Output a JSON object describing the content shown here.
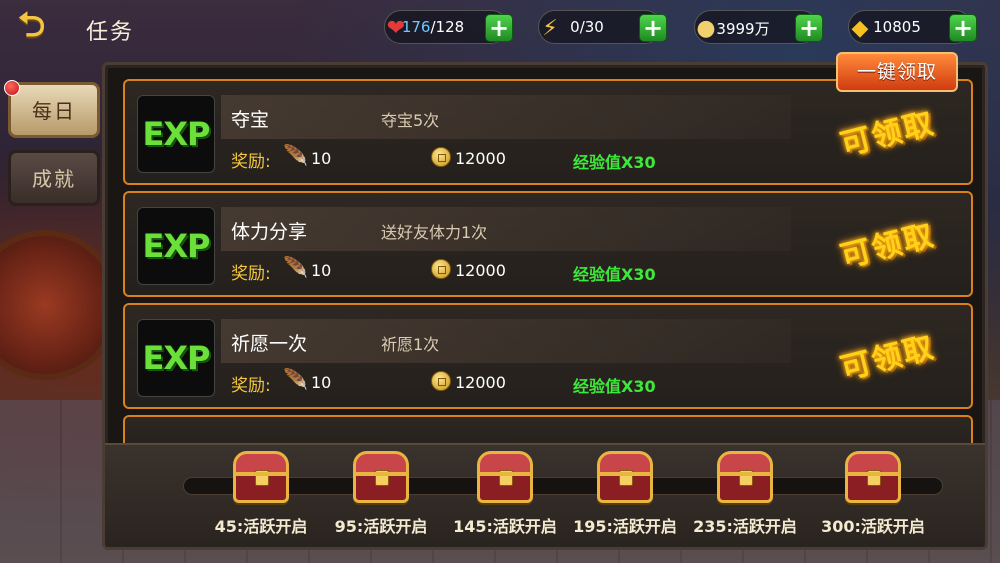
{
  "header": {
    "title": "任务",
    "back_icon": "back-arrow-icon"
  },
  "resources": [
    {
      "icon": "heart-icon",
      "current": "176",
      "max": "/128",
      "color": "#e23a3a"
    },
    {
      "icon": "lightning-icon",
      "value": "0/30",
      "color": "#f2c640"
    },
    {
      "icon": "coin-icon",
      "value": "3999万",
      "color": "#f2d070"
    },
    {
      "icon": "gold-ingot-icon",
      "value": "10805",
      "color": "#f5c020"
    }
  ],
  "side_tabs": {
    "daily": "每日",
    "achievement": "成就"
  },
  "claim_all": "一键领取",
  "tasks": [
    {
      "name": "夺宝",
      "desc": "夺宝5次",
      "reward_label": "奖励:",
      "wing": "10",
      "coins": "12000",
      "xp": "经验值X30",
      "status": "可领取",
      "icon_text": "EXP"
    },
    {
      "name": "体力分享",
      "desc": "送好友体力1次",
      "reward_label": "奖励:",
      "wing": "10",
      "coins": "12000",
      "xp": "经验值X30",
      "status": "可领取",
      "icon_text": "EXP"
    },
    {
      "name": "祈愿一次",
      "desc": "祈愿1次",
      "reward_label": "奖励:",
      "wing": "10",
      "coins": "12000",
      "xp": "经验值X30",
      "status": "可领取",
      "icon_text": "EXP"
    }
  ],
  "chests": [
    {
      "label": "45:活跃开启"
    },
    {
      "label": "95:活跃开启"
    },
    {
      "label": "145:活跃开启"
    },
    {
      "label": "195:活跃开启"
    },
    {
      "label": "235:活跃开启"
    },
    {
      "label": "300:活跃开启"
    }
  ]
}
